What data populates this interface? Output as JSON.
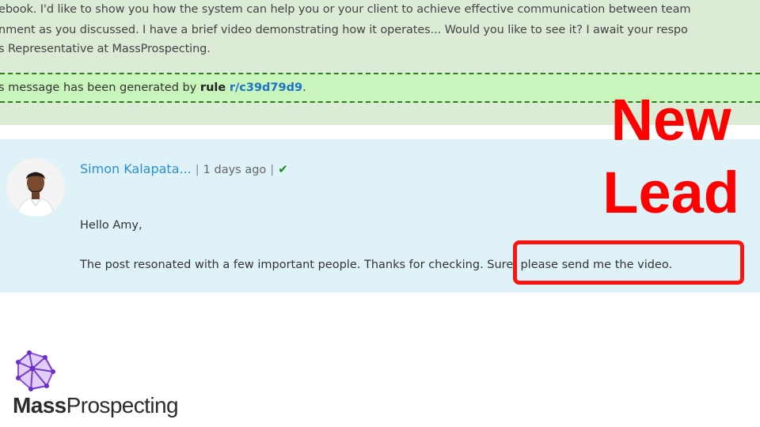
{
  "previous_message": {
    "line1": "ebook. I'd like to show you how the system can help you or your client to achieve effective communication between team",
    "line2": "nment as you discussed. I have a brief video demonstrating how it operates... Would you like to see it? I await your respo",
    "line3": "s Representative at MassProspecting.",
    "rule_note": {
      "prefix": "s message has been generated by ",
      "rule_label": "rule",
      "rule_id": "r/c39d79d9",
      "suffix": "."
    }
  },
  "reply": {
    "author": "Simon Kalapata...",
    "separator": "|",
    "time_ago": "1 days ago",
    "status_icon": "checkmark-icon",
    "greeting": "Hello Amy,",
    "body": "The post resonated with a few important people. Thanks for checking. Sure, please send me the video."
  },
  "annotation": {
    "line1": "New",
    "line2": "Lead",
    "color": "#ff0000"
  },
  "logo": {
    "bold_part": "Mass",
    "regular_part": "Prospecting",
    "icon": "geodesic-sphere-icon",
    "color": "#7a3fd0"
  }
}
